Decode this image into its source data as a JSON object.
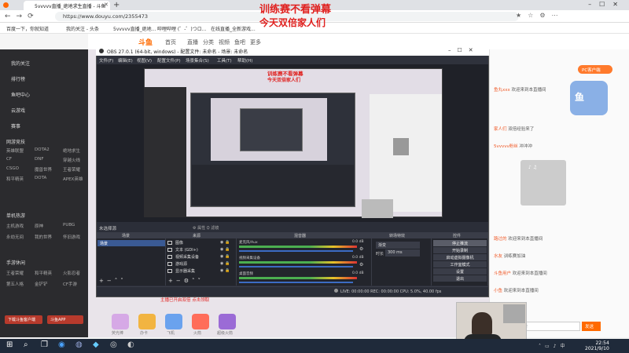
{
  "overlay": {
    "line1": "训练赛不看弹幕",
    "line2": "今天双倍家人们"
  },
  "browser": {
    "tab_title": "5vvvvv直播_绝地求生直播 - 斗鱼",
    "url": "https://www.douyu.com/2355473",
    "bookmarks": [
      "百度一下，你就知道",
      "我的关注 - 头条",
      "5vvvvv直播_绝地...",
      "哔哩哔哩 (゜-゜)つロ...",
      "在线直播_全新游戏..."
    ]
  },
  "douyu": {
    "nav": [
      "首页",
      "直播",
      "分类",
      "视频",
      "鱼吧",
      "更多"
    ],
    "sidebar_top": [
      "我的关注",
      "排行榜",
      "鱼吧中心",
      "云游戏",
      "赛事"
    ],
    "sidebar_group1": "网游竞技",
    "sidebar_items1": [
      "英雄联盟",
      "DOTA2",
      "绝地求生",
      "CF",
      "DNF",
      "穿越火线",
      "CSGO",
      "魔兽世界",
      "王者荣耀",
      "和平精英",
      "DOTA",
      "APEX英雄"
    ],
    "sidebar_group2": "单机热游",
    "sidebar_items2": [
      "主机游戏",
      "原神",
      "PUBG",
      "永劫无间",
      "我的世界",
      "怀旧游戏"
    ],
    "sidebar_group3": "手游休闲",
    "sidebar_items3": [
      "王者荣耀",
      "和平精英",
      "火影忍者",
      "第五人格",
      "金铲铲",
      "CF手游"
    ],
    "sidebar_btn1": "下载斗鱼客户端",
    "sidebar_btn2": "斗鱼APP",
    "pc_badge": "PC客户端",
    "chat_msgs": [
      {
        "user": "鱼丸xxx",
        "text": " 欢迎来到本直播间"
      },
      {
        "user": "家人们",
        "text": " 双倍经验来了"
      },
      {
        "user": "5vvvvv粉丝",
        "text": " 冲冲冲"
      },
      {
        "user": "路过的",
        "text": " 欢迎来到本直播间"
      },
      {
        "user": "水友",
        "text": " 训练赛加油"
      },
      {
        "user": "斗鱼用户",
        "text": " 欢迎来到本直播间"
      },
      {
        "user": "小鱼",
        "text": " 欢迎来到本直播间"
      }
    ],
    "chat_placeholder": "这里输入聊天内容",
    "send_label": "发送",
    "promo_text": "主播已开启双倍 点击领取",
    "gift_labels": [
      "荧光棒",
      "办卡",
      "飞机",
      "火箭",
      "超级火箭"
    ]
  },
  "obs": {
    "title": "OBS 27.0.1 (64-bit, windows) - 配置文件: 未命名 - 场景: 未命名",
    "menu": [
      "文件(F)",
      "编辑(E)",
      "视图(V)",
      "配置文件(P)",
      "场景集合(S)",
      "工具(T)",
      "帮助(H)"
    ],
    "scene_label": "未选择源",
    "lock_props": "属性",
    "lock_filters": "滤镜",
    "docks": [
      "场景",
      "来源",
      "混音器",
      "转场特效",
      "控件"
    ],
    "scenes": [
      "场景"
    ],
    "sources": [
      "图像",
      "文本 (GDI+)",
      "视频采集设备",
      "游戏源",
      "显示器采集"
    ],
    "mixer": [
      {
        "name": "麦克风/Aux",
        "db": "0.0 dB"
      },
      {
        "name": "视频采集设备",
        "db": "0.0 dB"
      },
      {
        "name": "桌面音频",
        "db": "0.0 dB"
      }
    ],
    "transition": "渐变",
    "duration_label": "时长",
    "duration_value": "300 ms",
    "controls": [
      "停止推流",
      "开始录制",
      "启动虚拟摄像机",
      "工作室模式",
      "设置",
      "退出"
    ],
    "status": "LIVE: 00:00:00   REC: 00:00:00   CPU: 5.0%, 40.00 fps"
  },
  "taskbar": {
    "time": "22:54",
    "date": "2021/9/10"
  }
}
